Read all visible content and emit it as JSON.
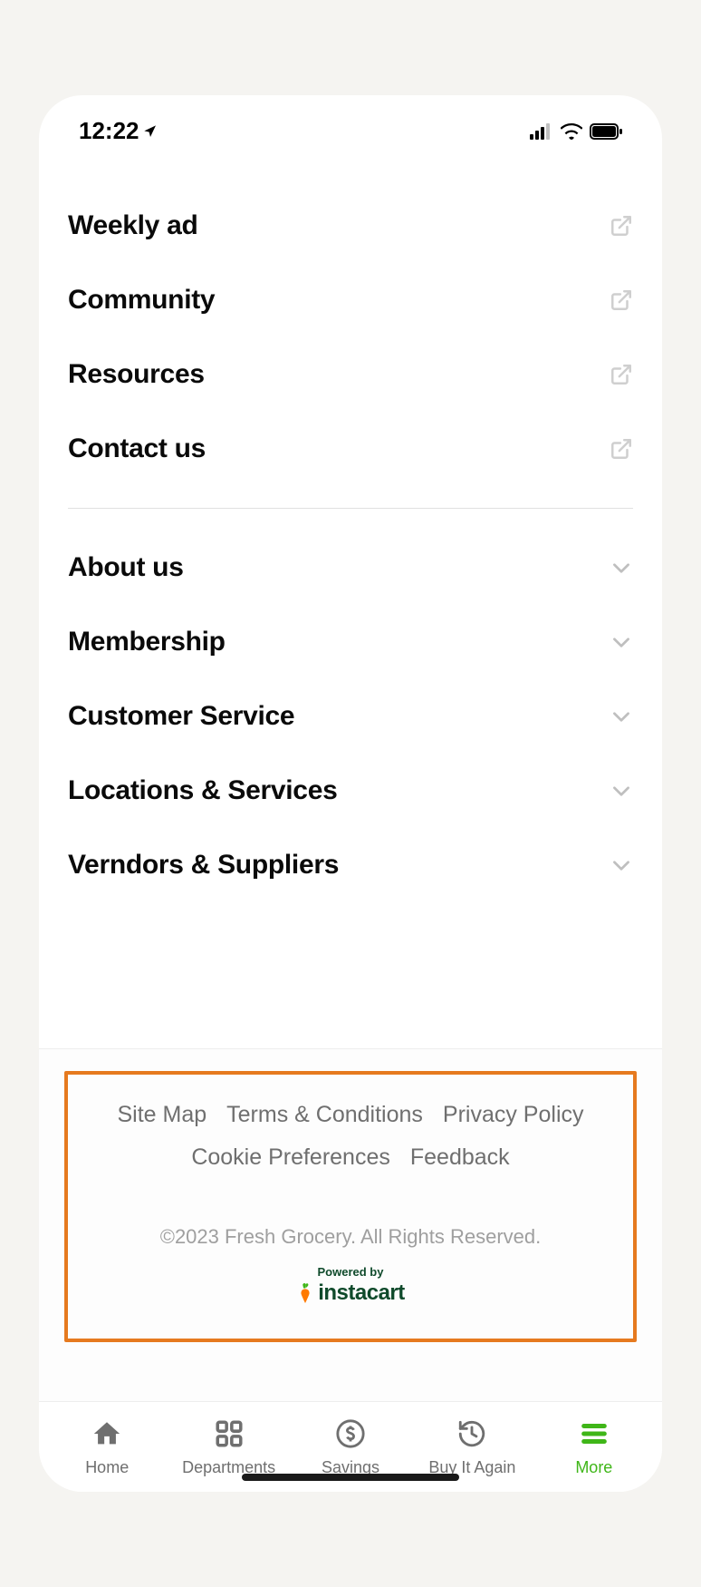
{
  "status": {
    "time": "12:22"
  },
  "links": [
    {
      "label": "Weekly ad"
    },
    {
      "label": "Community"
    },
    {
      "label": "Resources"
    },
    {
      "label": "Contact us"
    }
  ],
  "accordions": [
    {
      "label": "About us"
    },
    {
      "label": "Membership"
    },
    {
      "label": "Customer Service"
    },
    {
      "label": "Locations & Services"
    },
    {
      "label": "Verndors & Suppliers"
    }
  ],
  "footer": {
    "links": [
      "Site Map",
      "Terms & Conditions",
      "Privacy Policy",
      "Cookie Preferences",
      "Feedback"
    ],
    "copyright": "©2023 Fresh Grocery. All Rights Reserved.",
    "powered_label": "Powered by",
    "powered_brand": "instacart"
  },
  "tabs": [
    {
      "label": "Home"
    },
    {
      "label": "Departments"
    },
    {
      "label": "Savings"
    },
    {
      "label": "Buy It Again"
    },
    {
      "label": "More"
    }
  ],
  "colors": {
    "accent": "#3fb618",
    "highlight_border": "#e67a1f",
    "brand_dark": "#0f4a2b"
  }
}
